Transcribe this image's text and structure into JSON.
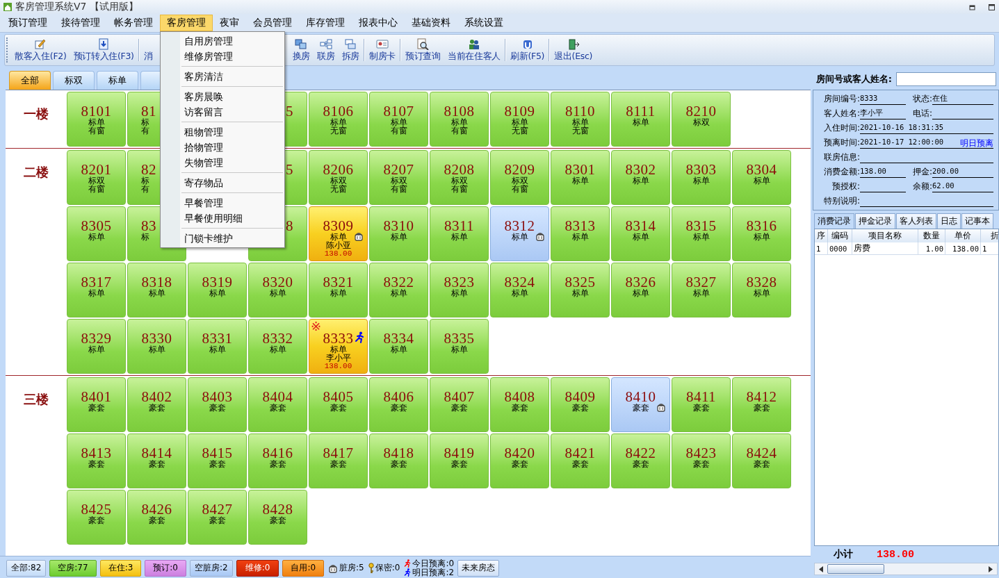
{
  "window": {
    "title": "客房管理系统V7 【试用版】"
  },
  "menubar": [
    {
      "label": "预订管理",
      "selected": false
    },
    {
      "label": "接待管理",
      "selected": false
    },
    {
      "label": "帐务管理",
      "selected": false
    },
    {
      "label": "客房管理",
      "selected": true
    },
    {
      "label": "夜审",
      "selected": false
    },
    {
      "label": "会员管理",
      "selected": false
    },
    {
      "label": "库存管理",
      "selected": false
    },
    {
      "label": "报表中心",
      "selected": false
    },
    {
      "label": "基础资料",
      "selected": false
    },
    {
      "label": "系统设置",
      "selected": false
    }
  ],
  "dropdown": [
    [
      "自用房管理",
      "维修房管理"
    ],
    [
      "客房清洁"
    ],
    [
      "客房晨唤",
      "访客留言"
    ],
    [
      "租物管理",
      "拾物管理",
      "失物管理"
    ],
    [
      "寄存物品"
    ],
    [
      "早餐管理",
      "早餐使用明细"
    ],
    [
      "门锁卡维护"
    ]
  ],
  "toolbar": [
    [
      {
        "kind": "button",
        "label": "散客入住(F2)"
      },
      {
        "kind": "button",
        "label": "预订转入住(F3)"
      }
    ],
    [
      {
        "kind": "covered",
        "label": "消"
      },
      {
        "kind": "button",
        "label": "换房"
      },
      {
        "kind": "button",
        "label": "联房"
      },
      {
        "kind": "button",
        "label": "拆房"
      }
    ],
    [
      {
        "kind": "button",
        "label": "制房卡"
      }
    ],
    [
      {
        "kind": "button",
        "label": "预订查询"
      },
      {
        "kind": "button",
        "label": "当前在住客人"
      }
    ],
    [
      {
        "kind": "button",
        "label": "刷新(F5)"
      }
    ],
    [
      {
        "kind": "button",
        "label": "退出(Esc)"
      }
    ]
  ],
  "tabs": [
    {
      "label": "全部",
      "selected": true
    },
    {
      "label": "标双",
      "selected": false
    },
    {
      "label": "标单",
      "selected": false
    },
    {
      "selected": false
    }
  ],
  "search": {
    "label": "房间号或客人姓名:"
  },
  "floors": [
    {
      "label": "一楼",
      "rooms": [
        {
          "number": "8101",
          "type": "标单",
          "feature": "有窗",
          "kind": "vacant"
        },
        {
          "number": "81",
          "type": "标",
          "feature": "有",
          "kind": "vacant"
        },
        {
          "kind": "covered"
        },
        {
          "number": "5",
          "kind": "vacant"
        },
        {
          "number": "8106",
          "type": "标单",
          "feature": "无窗",
          "kind": "vacant"
        },
        {
          "number": "8107",
          "type": "标单",
          "feature": "有窗",
          "kind": "vacant"
        },
        {
          "number": "8108",
          "type": "标单",
          "feature": "有窗",
          "kind": "vacant"
        },
        {
          "number": "8109",
          "type": "标单",
          "feature": "无窗",
          "kind": "vacant"
        },
        {
          "number": "8110",
          "type": "标单",
          "feature": "无窗",
          "kind": "vacant"
        },
        {
          "number": "8111",
          "type": "标单",
          "kind": "vacant"
        },
        {
          "number": "8210",
          "type": "标双",
          "kind": "vacant"
        }
      ]
    },
    {
      "label": "二楼",
      "rooms": [
        {
          "number": "8201",
          "type": "标双",
          "feature": "有窗",
          "kind": "vacant"
        },
        {
          "number": "82",
          "type": "标",
          "feature": "有",
          "kind": "vacant"
        },
        {
          "kind": "covered"
        },
        {
          "number": "5",
          "kind": "vacant"
        },
        {
          "number": "8206",
          "type": "标双",
          "feature": "无窗",
          "kind": "vacant"
        },
        {
          "number": "8207",
          "type": "标双",
          "feature": "有窗",
          "kind": "vacant"
        },
        {
          "number": "8208",
          "type": "标双",
          "feature": "有窗",
          "kind": "vacant"
        },
        {
          "number": "8209",
          "type": "标双",
          "feature": "有窗",
          "kind": "vacant"
        },
        {
          "number": "8301",
          "type": "标单",
          "kind": "vacant"
        },
        {
          "number": "8302",
          "type": "标单",
          "kind": "vacant"
        },
        {
          "number": "8303",
          "type": "标单",
          "kind": "vacant"
        },
        {
          "number": "8304",
          "type": "标单",
          "kind": "vacant"
        },
        {
          "number": "8305",
          "type": "标单",
          "kind": "vacant"
        },
        {
          "number": "83",
          "type": "标",
          "kind": "vacant"
        },
        {
          "kind": "covered"
        },
        {
          "number": "8",
          "kind": "vacant"
        },
        {
          "number": "8309",
          "type": "标单",
          "guest": "陈小亚",
          "amount": "138.00",
          "kind": "occupied",
          "dirty": true
        },
        {
          "number": "8310",
          "type": "标单",
          "kind": "vacant"
        },
        {
          "number": "8311",
          "type": "标单",
          "kind": "vacant"
        },
        {
          "number": "8312",
          "type": "标单",
          "kind": "vacant_dirty",
          "dirty": true
        },
        {
          "number": "8313",
          "type": "标单",
          "kind": "vacant"
        },
        {
          "number": "8314",
          "type": "标单",
          "kind": "vacant"
        },
        {
          "number": "8315",
          "type": "标单",
          "kind": "vacant"
        },
        {
          "number": "8316",
          "type": "标单",
          "kind": "vacant"
        },
        {
          "number": "8317",
          "type": "标单",
          "kind": "vacant"
        },
        {
          "number": "8318",
          "type": "标单",
          "kind": "vacant"
        },
        {
          "number": "8319",
          "type": "标单",
          "kind": "vacant"
        },
        {
          "number": "8320",
          "type": "标单",
          "kind": "vacant"
        },
        {
          "number": "8321",
          "type": "标单",
          "kind": "vacant"
        },
        {
          "number": "8322",
          "type": "标单",
          "kind": "vacant"
        },
        {
          "number": "8323",
          "type": "标单",
          "kind": "vacant"
        },
        {
          "number": "8324",
          "type": "标单",
          "kind": "vacant"
        },
        {
          "number": "8325",
          "type": "标单",
          "kind": "vacant"
        },
        {
          "number": "8326",
          "type": "标单",
          "kind": "vacant"
        },
        {
          "number": "8327",
          "type": "标单",
          "kind": "vacant"
        },
        {
          "number": "8328",
          "type": "标单",
          "kind": "vacant"
        },
        {
          "number": "8329",
          "type": "标单",
          "kind": "vacant"
        },
        {
          "number": "8330",
          "type": "标单",
          "kind": "vacant"
        },
        {
          "number": "8331",
          "type": "标单",
          "kind": "vacant"
        },
        {
          "number": "8332",
          "type": "标单",
          "kind": "vacant"
        },
        {
          "number": "8333",
          "type": "标单",
          "guest": "李小平",
          "amount": "138.00",
          "kind": "occupied",
          "mark": "※",
          "departs_tomorrow": true
        },
        {
          "number": "8334",
          "type": "标单",
          "kind": "vacant"
        },
        {
          "number": "8335",
          "type": "标单",
          "kind": "vacant"
        }
      ]
    },
    {
      "label": "三楼",
      "rooms": [
        {
          "number": "8401",
          "type": "豪套",
          "kind": "vacant"
        },
        {
          "number": "8402",
          "type": "豪套",
          "kind": "vacant"
        },
        {
          "number": "8403",
          "type": "豪套",
          "kind": "vacant"
        },
        {
          "number": "8404",
          "type": "豪套",
          "kind": "vacant"
        },
        {
          "number": "8405",
          "type": "豪套",
          "kind": "vacant"
        },
        {
          "number": "8406",
          "type": "豪套",
          "kind": "vacant"
        },
        {
          "number": "8407",
          "type": "豪套",
          "kind": "vacant"
        },
        {
          "number": "8408",
          "type": "豪套",
          "kind": "vacant"
        },
        {
          "number": "8409",
          "type": "豪套",
          "kind": "vacant"
        },
        {
          "number": "8410",
          "type": "豪套",
          "kind": "vacant_dirty",
          "dirty": true
        },
        {
          "number": "8411",
          "type": "豪套",
          "kind": "vacant"
        },
        {
          "number": "8412",
          "type": "豪套",
          "kind": "vacant"
        },
        {
          "number": "8413",
          "type": "豪套",
          "kind": "vacant"
        },
        {
          "number": "8414",
          "type": "豪套",
          "kind": "vacant"
        },
        {
          "number": "8415",
          "type": "豪套",
          "kind": "vacant"
        },
        {
          "number": "8416",
          "type": "豪套",
          "kind": "vacant"
        },
        {
          "number": "8417",
          "type": "豪套",
          "kind": "vacant"
        },
        {
          "number": "8418",
          "type": "豪套",
          "kind": "vacant"
        },
        {
          "number": "8419",
          "type": "豪套",
          "kind": "vacant"
        },
        {
          "number": "8420",
          "type": "豪套",
          "kind": "vacant"
        },
        {
          "number": "8421",
          "type": "豪套",
          "kind": "vacant"
        },
        {
          "number": "8422",
          "type": "豪套",
          "kind": "vacant"
        },
        {
          "number": "8423",
          "type": "豪套",
          "kind": "vacant"
        },
        {
          "number": "8424",
          "type": "豪套",
          "kind": "vacant"
        },
        {
          "number": "8425",
          "type": "豪套",
          "kind": "vacant"
        },
        {
          "number": "8426",
          "type": "豪套",
          "kind": "vacant"
        },
        {
          "number": "8427",
          "type": "豪套",
          "kind": "vacant"
        },
        {
          "number": "8428",
          "type": "豪套",
          "kind": "vacant"
        }
      ]
    }
  ],
  "status_bar": [
    {
      "kind": "all",
      "label": "全部:82"
    },
    {
      "kind": "vacant",
      "label": "空房:77"
    },
    {
      "kind": "occupied",
      "label": "在住:3"
    },
    {
      "kind": "reserved",
      "label": "预订:0"
    },
    {
      "kind": "vacant_dirty",
      "label": "空脏房:2"
    },
    {
      "kind": "repair",
      "label": "维修:0"
    },
    {
      "kind": "self_use",
      "label": "自用:0"
    },
    {
      "kind": "dirty",
      "label": "脏房:5"
    },
    {
      "kind": "secret",
      "label": "保密:0"
    },
    {
      "kind": "departures",
      "lines": [
        {
          "label": "今日预离:0",
          "color": "#ff0000"
        },
        {
          "label": "明日预离:2",
          "color": "#0000ff"
        }
      ]
    },
    {
      "kind": "button",
      "label": "未来房态"
    }
  ],
  "info": [
    [
      {
        "label": "房间编号:",
        "value": "8333"
      },
      {
        "label": "状态:",
        "value": "在住"
      }
    ],
    [
      {
        "label": "客人姓名:",
        "value": "李小平"
      },
      {
        "label": "电话:"
      }
    ],
    [
      {
        "label": "入住时间:",
        "value": "2021-10-16 18:31:35"
      }
    ],
    [
      {
        "label": "预离时间:",
        "value": "2021-10-17 12:00:00",
        "link": "明日预离"
      }
    ],
    [
      {
        "label": "联房信息:"
      }
    ],
    [
      {
        "label": "消费金额:",
        "value": "138.00"
      },
      {
        "label": "押金:",
        "value": "200.00"
      }
    ],
    [
      {
        "label": "预授权:"
      },
      {
        "label": "余额:",
        "value": "62.00"
      }
    ],
    [
      {
        "label": "特别说明:"
      }
    ]
  ],
  "detail_tabs": [
    {
      "label": "消费记录",
      "selected": true
    },
    {
      "label": "押金记录",
      "selected": false
    },
    {
      "label": "客人列表",
      "selected": false
    },
    {
      "label": "日志",
      "selected": false
    },
    {
      "label": "记事本",
      "selected": false
    }
  ],
  "table": {
    "columns": [
      "序",
      "编码",
      "项目名称",
      "数量",
      "单价",
      "折"
    ],
    "rows": [
      [
        "1",
        "0000",
        "房费",
        "1.00",
        "138.00",
        "1"
      ]
    ]
  },
  "subtotal": {
    "label": "小计",
    "value": "138.00"
  }
}
